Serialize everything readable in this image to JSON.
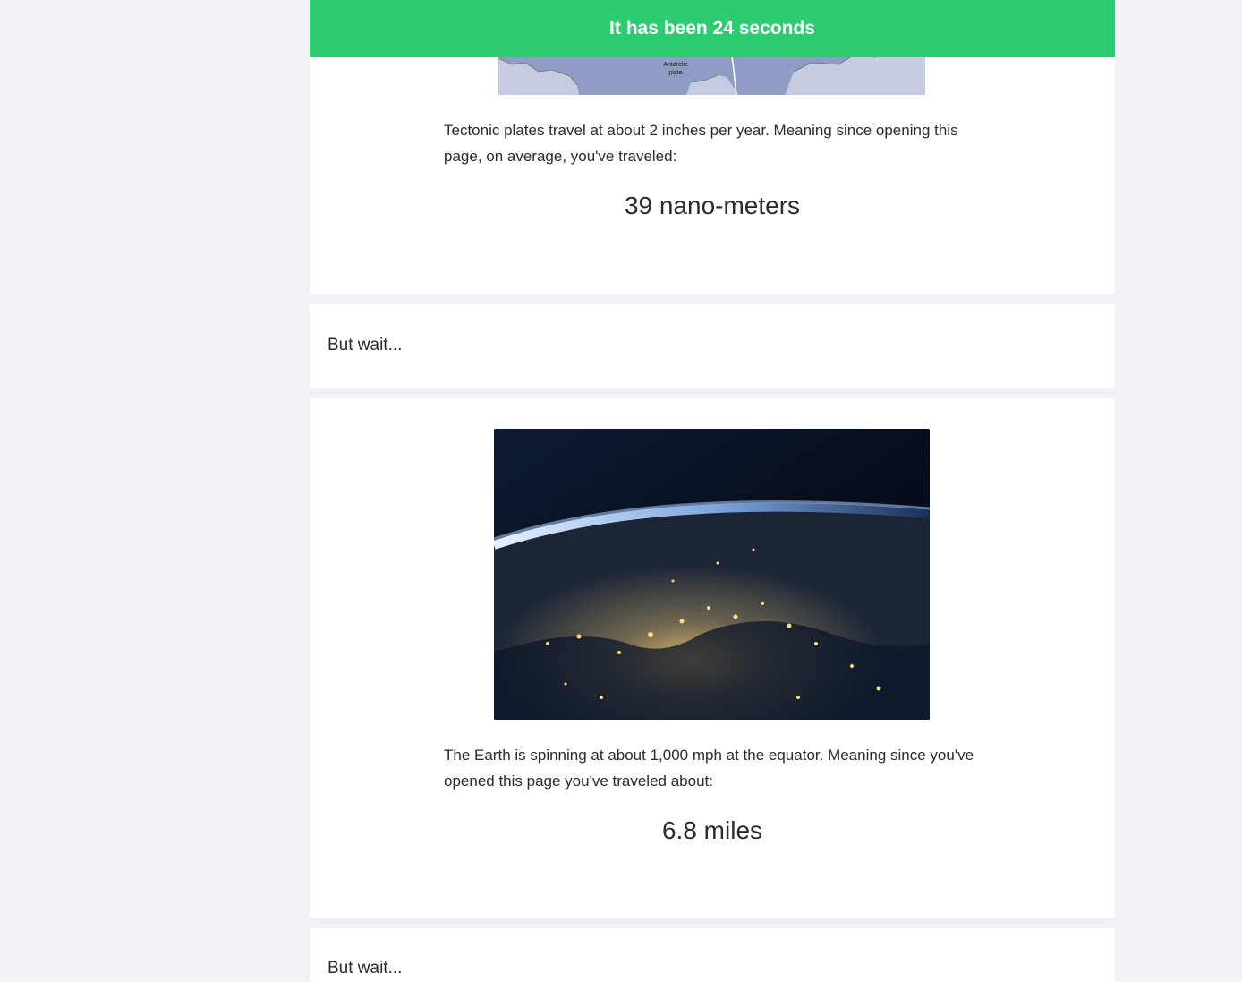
{
  "banner": {
    "text": "It has been 24 seconds"
  },
  "tectonic": {
    "map_label": "Antarctic plate",
    "description": "Tectonic plates travel at about 2 inches per year. Meaning since opening this page, on average, you've traveled:",
    "distance": "39 nano-meters"
  },
  "wait_1": {
    "text": "But wait..."
  },
  "earth": {
    "image_icon": "earth-night-photo",
    "description": "The Earth is spinning at about 1,000 mph at the equator. Meaning since you've opened this page you've traveled about:",
    "distance": "6.8 miles"
  },
  "wait_2": {
    "text": "But wait..."
  },
  "colors": {
    "banner": "#2ecc71",
    "page_background": "#f0f2f5",
    "card": "#ffffff",
    "text": "#2b2b2b"
  }
}
